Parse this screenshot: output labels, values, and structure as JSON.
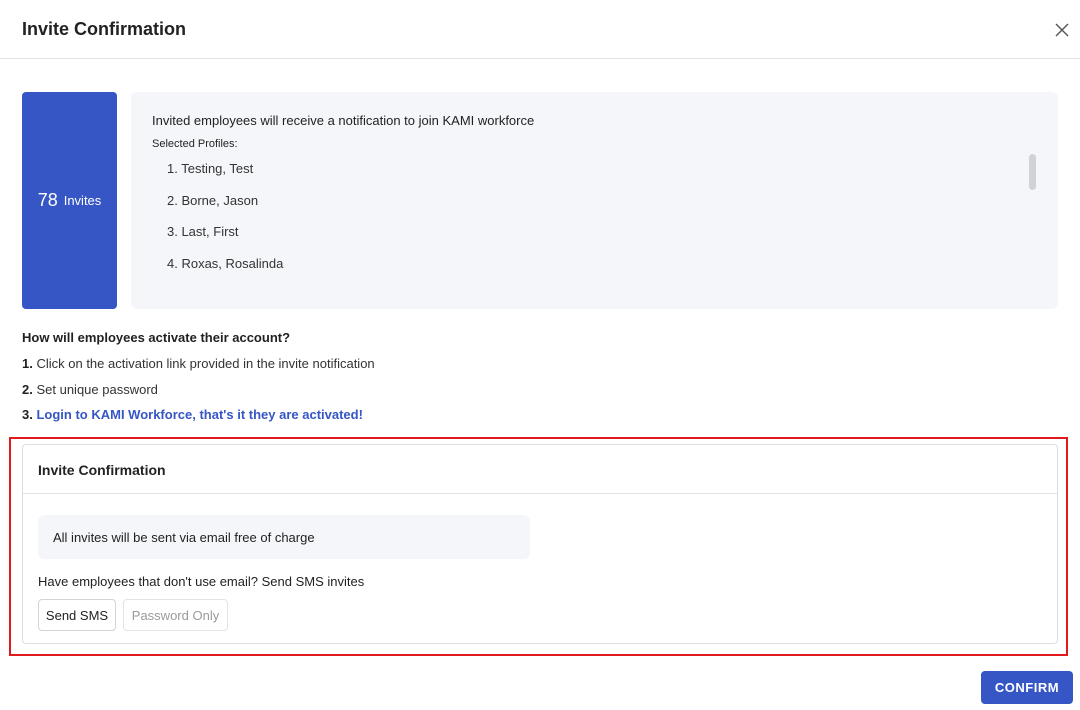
{
  "modal": {
    "title": "Invite Confirmation"
  },
  "summary": {
    "count": "78",
    "count_label": "Invites",
    "intro": "Invited employees will receive a notification to join KAMI workforce",
    "profiles_label": "Selected Profiles:",
    "profiles": [
      "1. Testing, Test",
      "2. Borne, Jason",
      "3. Last, First",
      "4. Roxas, Rosalinda"
    ]
  },
  "activation": {
    "title": "How will employees activate their account?",
    "steps": [
      {
        "num": "1.",
        "text": "Click on the activation link provided in the invite notification"
      },
      {
        "num": "2.",
        "text": "Set unique password"
      },
      {
        "num": "3.",
        "text": "Login to KAMI Workforce, that's it they are activated!"
      }
    ]
  },
  "confirmation_card": {
    "title": "Invite Confirmation",
    "email_note": "All invites will be sent via email free of charge",
    "sms_question": "Have employees that don't use email? Send SMS invites",
    "send_sms_label": "Send SMS",
    "password_only_label": "Password Only"
  },
  "footer": {
    "confirm_label": "CONFIRM"
  },
  "colors": {
    "primary": "#3556c4",
    "highlight": "#e01a1a",
    "panel_bg": "#f5f6fa"
  },
  "icons": {
    "close": "close-icon"
  }
}
